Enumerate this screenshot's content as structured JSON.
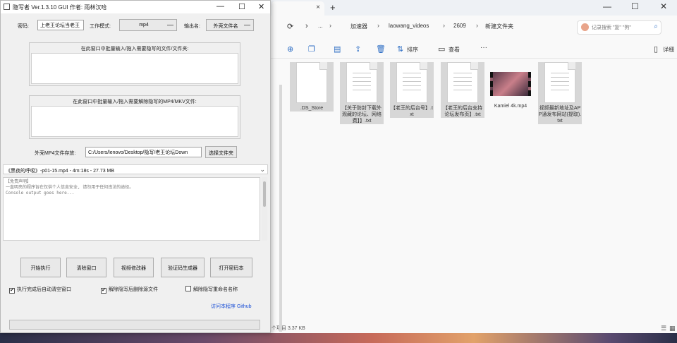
{
  "explorer": {
    "tab_close": "×",
    "new_tab": "+",
    "window_controls": {
      "minimize": "—",
      "maximize": "☐",
      "close": "✕"
    },
    "nav_icons": {
      "refresh": "⟳",
      "expand": "›",
      "expand2": "›"
    },
    "breadcrumbs": [
      "加速器",
      "laowang_videos",
      "2609",
      "新建文件夹"
    ],
    "breadcrumb_separator": "›",
    "breadcrumb_more": "...",
    "search_placeholder": "记录搜索 \"复\" \"狗\"",
    "toolbar": {
      "sort_label": "排序",
      "view_label": "查看",
      "more": "···",
      "details_label": "详细"
    },
    "files": [
      {
        "name": ".DS_Store",
        "type": "doc",
        "selected": true
      },
      {
        "name": "【关于防封下载外观藏的论坛、网络费】】.txt",
        "type": "doc",
        "selected": true
      },
      {
        "name": "【老王的后台号】.txt",
        "type": "doc",
        "selected": true
      },
      {
        "name": "【老王的后台支持论坛发布页】.txt",
        "type": "doc",
        "selected": true
      },
      {
        "name": "Kamiel 4k.mp4",
        "type": "video",
        "selected": false
      },
      {
        "name": "视频最新地址及APP通发布网站(提取).txt",
        "type": "doc",
        "selected": true
      }
    ],
    "status_text": "个项目 3.37 KB"
  },
  "tool": {
    "title": "隐写者 Ver.1.3.10 GUI 作者: 雨林汉哈",
    "window_controls": {
      "minimize": "—",
      "maximize": "☐",
      "close": "✕"
    },
    "password_label": "密码:",
    "password_value": "上老王论坛当老王",
    "mode_label": "工作模式:",
    "mode_value": "mp4",
    "output_label": "输出名:",
    "output_value": "外壳文件名",
    "dropdown_arrow": "—",
    "frame1_caption": "在此窗口中批量输入/拖入需要隐写的文件/文件夹:",
    "frame2_caption": "在此窗口中批量输入/拖入需要解除隐写的MP4/MKV文件:",
    "cover_label": "外壳MP4文件存放:",
    "cover_path": "C:/Users/lenovo/Desktop/隐写/老王论坛Down",
    "choose_file_btn": "选择文件夹",
    "combo_value": "《黑夜的呼吸》-p01-15.mp4 - 4m:18s - 27.73 MB",
    "combo_arrow": "⌄",
    "console_lines": [
      "【免责声明】",
      "一直明亮的程序旨在仅供个人信息安全, 请勿用于任何违法的途径。",
      "Console output goes here..."
    ],
    "buttons": {
      "start": "开始执行",
      "clear": "清除窗口",
      "fix": "视频修改器",
      "verify": "验证码生成器",
      "open_password": "打开密码本"
    },
    "checkboxes": [
      {
        "label": "执行完成后自动清空窗口",
        "checked": true,
        "mark": "✔"
      },
      {
        "label": "解除隐写后删除源文件",
        "checked": true,
        "mark": "✔"
      },
      {
        "label": "解除隐写重命名名称",
        "checked": false,
        "mark": ""
      }
    ],
    "link_text": "访问本程序 Github",
    "progress": 0
  }
}
